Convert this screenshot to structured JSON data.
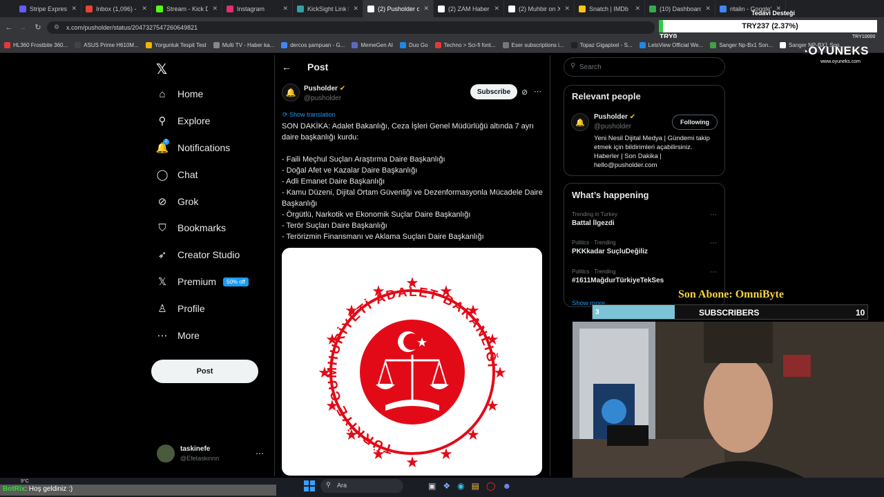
{
  "browser": {
    "tabs": [
      {
        "label": "Stripe Express",
        "color": "#635bff",
        "active": false
      },
      {
        "label": "Inbox (1,096) - kickta",
        "color": "#ea4335",
        "active": false
      },
      {
        "label": "Stream - Kick Dashbo",
        "color": "#53fc18",
        "active": false
      },
      {
        "label": "Instagram",
        "color": "#e1306c",
        "active": false
      },
      {
        "label": "KickSight Link Detect",
        "color": "#34a0a4",
        "active": false
      },
      {
        "label": "(2) Pusholder on X: \"SON",
        "color": "#ffffff",
        "active": true
      },
      {
        "label": "(2) ZAM Haber on X:",
        "color": "#ffffff",
        "active": false
      },
      {
        "label": "(2) Muhbir on X:",
        "color": "#ffffff",
        "active": false
      },
      {
        "label": "Snatch | IMDb",
        "color": "#f5c518",
        "active": false
      },
      {
        "label": "(10) Dashboard",
        "color": "#34a853",
        "active": false
      },
      {
        "label": "ritalin - Google'da Ara",
        "color": "#4285f4",
        "active": false
      }
    ],
    "url": "x.com/pusholder/status/2047327547260649821",
    "bookmarks": [
      {
        "label": "HL360 Frostbite 360...",
        "color": "#e53935"
      },
      {
        "label": "ASUS Prime H610M...",
        "color": "#444444"
      },
      {
        "label": "Yorgunluk Tespit Test",
        "color": "#f4b400"
      },
      {
        "label": "Multi TV - Haber ka...",
        "color": "#888888"
      },
      {
        "label": "dercos şampuan - G...",
        "color": "#4285f4"
      },
      {
        "label": "MemeGen AI",
        "color": "#5c6bc0"
      },
      {
        "label": "Duo Go",
        "color": "#1e88e5"
      },
      {
        "label": "Techno > Sci-fi font...",
        "color": "#e53935"
      },
      {
        "label": "Eser subscriptions i...",
        "color": "#777777"
      },
      {
        "label": "Topaz Gigapixel - S...",
        "color": "#222222"
      },
      {
        "label": "LetsView Official We...",
        "color": "#1e88e5"
      },
      {
        "label": "Sanger Np-Bx1 Son...",
        "color": "#43a047"
      },
      {
        "label": "Sanger NP-BX1 Son...",
        "color": "#ffffff"
      }
    ]
  },
  "ticker": {
    "label": "Tedavi Desteği",
    "value": "TRY237 (2.37%)",
    "min": "TRY0",
    "max": "TRY10000"
  },
  "brand": {
    "name": "OYUNEKS",
    "site": "www.oyuneks.com"
  },
  "sidebar": {
    "items": [
      {
        "label": "Home",
        "icon": "⌂"
      },
      {
        "label": "Explore",
        "icon": "⚲"
      },
      {
        "label": "Notifications",
        "icon": "🔔",
        "badge": "2"
      },
      {
        "label": "Chat",
        "icon": "◯"
      },
      {
        "label": "Grok",
        "icon": "⊘"
      },
      {
        "label": "Bookmarks",
        "icon": "⛉"
      },
      {
        "label": "Creator Studio",
        "icon": "➶"
      },
      {
        "label": "Premium",
        "icon": "𝕏"
      },
      {
        "label": "Profile",
        "icon": "♙"
      },
      {
        "label": "More",
        "icon": "⋯"
      }
    ],
    "premium_badge": "50% off",
    "post_button": "Post",
    "account": {
      "name": "taskinefe",
      "handle": "@Efetaskinnn"
    }
  },
  "post": {
    "header": "Post",
    "author": {
      "name": "Pusholder",
      "handle": "@pusholder"
    },
    "subscribe": "Subscribe",
    "show_translation": "Show translation",
    "lines": [
      "SON DAKİKA: Adalet Bakanlığı, Ceza İşleri Genel Müdürlüğü altında 7 ayrı daire başkanlığı kurdu:",
      "",
      "- Faili Meçhul Suçları Araştırma Daire Başkanlığı",
      "- Doğal Afet ve Kazalar Daire Başkanlığı",
      "- Adli Emanet Daire Başkanlığı",
      "- Kamu Düzeni, Dijital Ortam Güvenliği ve Dezenformasyonla Mücadele Daire Başkanlığı",
      "- Örgütlü, Narkotik ve Ekonomik Suçlar Daire Başkanlığı",
      "- Terör Suçları Daire Başkanlığı",
      "- Terörizmin Finansmanı ve Aklama Suçları Daire Başkanlığı"
    ],
    "seal_text": "TÜRKİYE CUMHURİYETİ ADALET BAKANLIĞI"
  },
  "right": {
    "search_placeholder": "Search",
    "relevant_title": "Relevant people",
    "person": {
      "name": "Pusholder",
      "handle": "@pusholder",
      "follow": "Following",
      "bio": "Yeni Nesil Dijital Medya | Gündemi takip etmek için bildirimleri açabilirsiniz. Haberler | Son Dakika | hello@pusholder.com"
    },
    "happening_title": "What’s happening",
    "trends": [
      {
        "meta": "Trending in Turkey",
        "name": "Battal İlgezdi"
      },
      {
        "meta": "Politics · Trending",
        "name": "PKKkadar SuçluDeğiliz"
      },
      {
        "meta": "Politics · Trending",
        "name": "#1611MağdurTürkiyeTekSes"
      }
    ],
    "show_more": "Show more"
  },
  "overlay": {
    "son_abone": "Son Abone: OmniByte",
    "sub_current": "3",
    "sub_label": "SUBSCRIBERS",
    "sub_goal": "10",
    "sub_progress": 0.3
  },
  "chat": {
    "user": "BotRix",
    "message": ": Hoş geldiniz :)"
  },
  "taskbar": {
    "weather": "9°C",
    "search": "Ara"
  }
}
